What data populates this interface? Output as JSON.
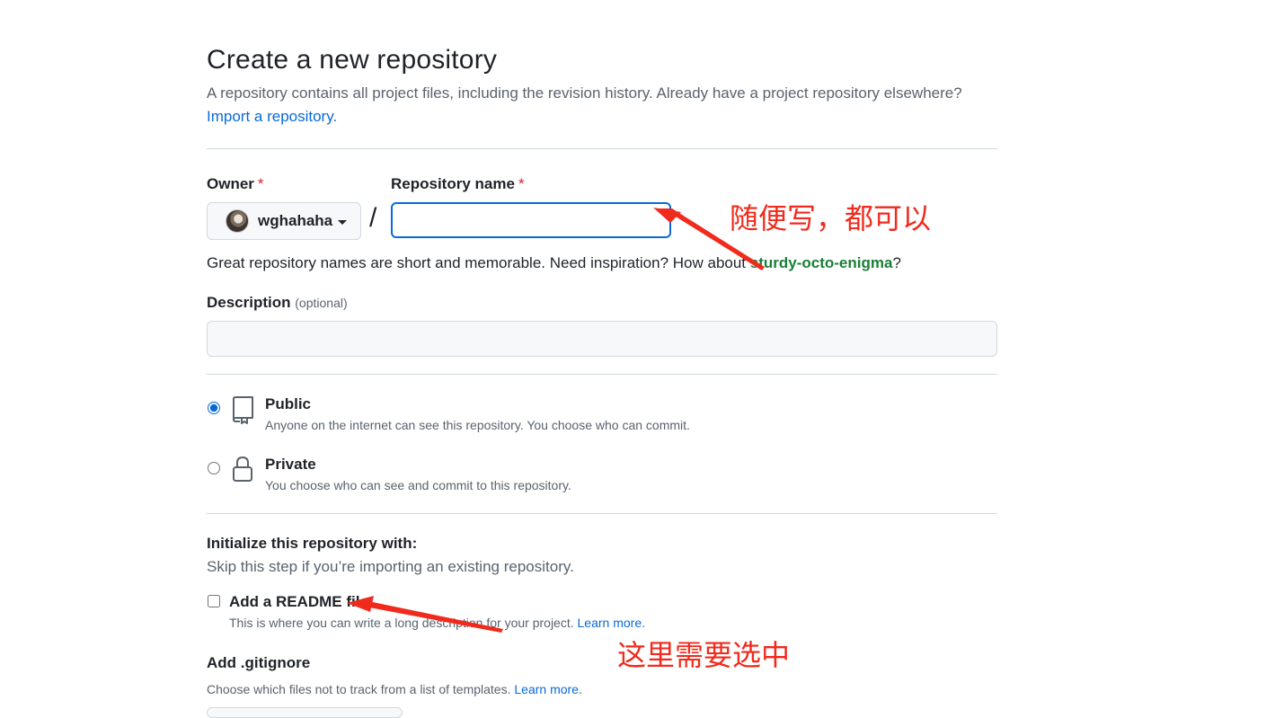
{
  "header": {
    "title": "Create a new repository",
    "subtitle": "A repository contains all project files, including the revision history. Already have a project repository elsewhere?",
    "import_link": "Import a repository."
  },
  "owner": {
    "label": "Owner",
    "required_mark": "*",
    "value": "wghahaha"
  },
  "separator": "/",
  "repo_name": {
    "label": "Repository name",
    "required_mark": "*",
    "value": ""
  },
  "name_hint": {
    "text": "Great repository names are short and memorable. Need inspiration? How about ",
    "suggestion": "sturdy-octo-enigma",
    "suffix": "?"
  },
  "description": {
    "label": "Description",
    "optional": "(optional)",
    "value": ""
  },
  "visibility": {
    "selected": "Public",
    "options": [
      {
        "title": "Public",
        "desc": "Anyone on the internet can see this repository. You choose who can commit."
      },
      {
        "title": "Private",
        "desc": "You choose who can see and commit to this repository."
      }
    ]
  },
  "initialize": {
    "title": "Initialize this repository with:",
    "subtitle": "Skip this step if you’re importing an existing repository.",
    "readme_label": "Add a README file",
    "readme_checked": false,
    "readme_desc": "This is where you can write a long description for your project.",
    "readme_learn_more": "Learn more."
  },
  "gitignore": {
    "title": "Add .gitignore",
    "desc": "Choose which files not to track from a list of templates.",
    "learn_more": "Learn more."
  },
  "annotations": {
    "name_note": "随便写，都可以",
    "readme_note": "这里需要选中",
    "color": "#f02a1c"
  }
}
